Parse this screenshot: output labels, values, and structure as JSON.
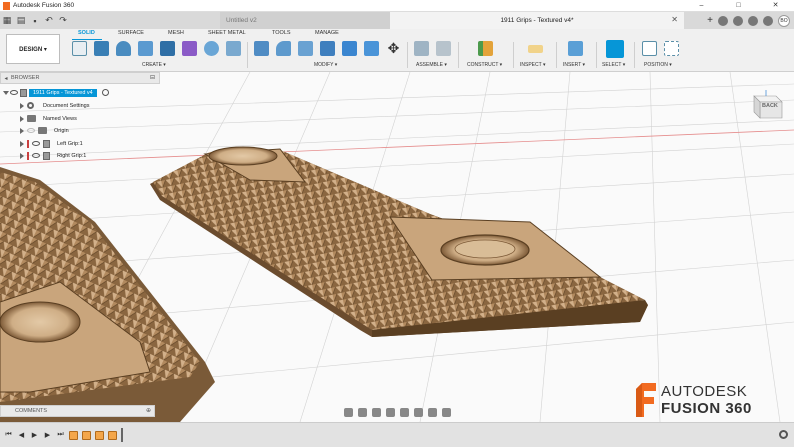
{
  "app": {
    "title": "Autodesk Fusion 360"
  },
  "window_controls": {
    "minimize": "–",
    "maximize": "□",
    "close": "✕"
  },
  "tabs": {
    "inactive": {
      "label": "Untitled v2"
    },
    "active": {
      "label": "1911 Grips - Textured v4*"
    },
    "close_glyph": "✕",
    "user_initials": "BO"
  },
  "toolbar": {
    "new_tab": "+"
  },
  "ribbon": {
    "workspace": "DESIGN ▾",
    "tabs": [
      "SOLID",
      "SURFACE",
      "MESH",
      "SHEET METAL",
      "TOOLS",
      "MANAGE"
    ],
    "active_tab": "SOLID",
    "groups": [
      "CREATE ▾",
      "MODIFY ▾",
      "ASSEMBLE ▾",
      "CONSTRUCT ▾",
      "INSPECT ▾",
      "INSERT ▾",
      "SELECT ▾",
      "POSITION ▾"
    ],
    "accent_color": "#0696d7"
  },
  "browser": {
    "header": "BROWSER",
    "root": "1911 Grips - Textured v4",
    "items": [
      {
        "label": "Document Settings",
        "icon": "gear-icon"
      },
      {
        "label": "Named Views",
        "icon": "folder-icon"
      },
      {
        "label": "Origin",
        "icon": "folder-icon"
      },
      {
        "label": "Left Grip:1",
        "icon": "body-icon"
      },
      {
        "label": "Right Grip:1",
        "icon": "body-icon"
      }
    ]
  },
  "viewcube": {
    "face_label": "BACK"
  },
  "comments": {
    "label": "COMMENTS"
  },
  "branding": {
    "line1": "AUTODESK",
    "line2": "FUSION 360",
    "logo_color": "#f26b21"
  }
}
